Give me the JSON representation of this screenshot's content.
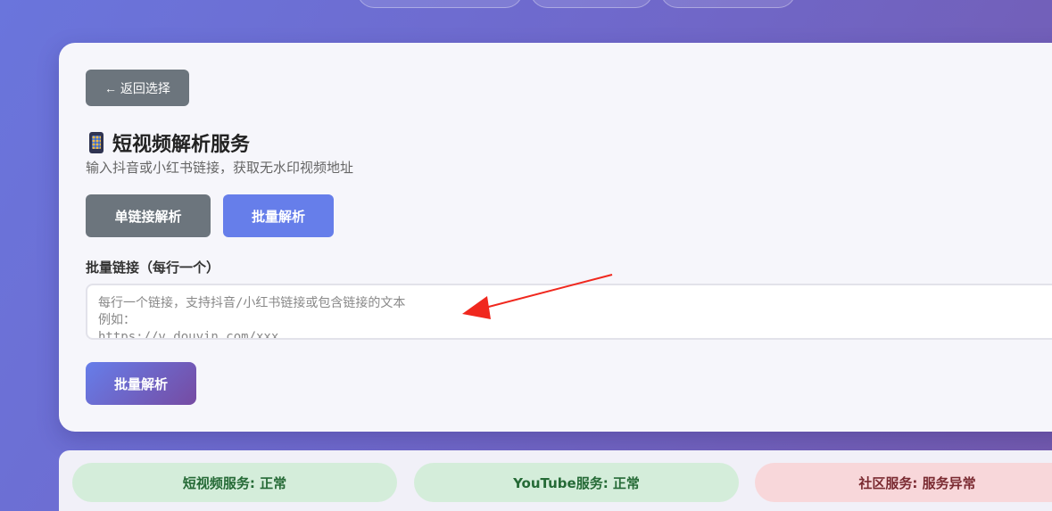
{
  "nav": {
    "back_label": "← 返回选择"
  },
  "service": {
    "icon": "mobile-phone-icon",
    "title": "短视频解析服务",
    "subtitle": "输入抖音或小红书链接，获取无水印视频地址"
  },
  "modes": {
    "single_label": "单链接解析",
    "batch_label": "批量解析",
    "active": "batch"
  },
  "batch_form": {
    "field_label": "批量链接（每行一个）",
    "value": "",
    "placeholder": "每行一个链接，支持抖音/小红书链接或包含链接的文本\n例如：\nhttps://v.douyin.com/xxx",
    "submit_label": "批量解析"
  },
  "status": [
    {
      "label": "短视频服务: 正常",
      "state": "ok"
    },
    {
      "label": "YouTube服务: 正常",
      "state": "ok"
    },
    {
      "label": "社区服务: 服务异常",
      "state": "error"
    }
  ],
  "colors": {
    "primary": "#667eea",
    "secondary": "#6c757d",
    "gradient_end": "#764ba2",
    "status_ok_bg": "#d4edda",
    "status_error_bg": "#f8d7da",
    "annotation_arrow": "#f0281e"
  }
}
